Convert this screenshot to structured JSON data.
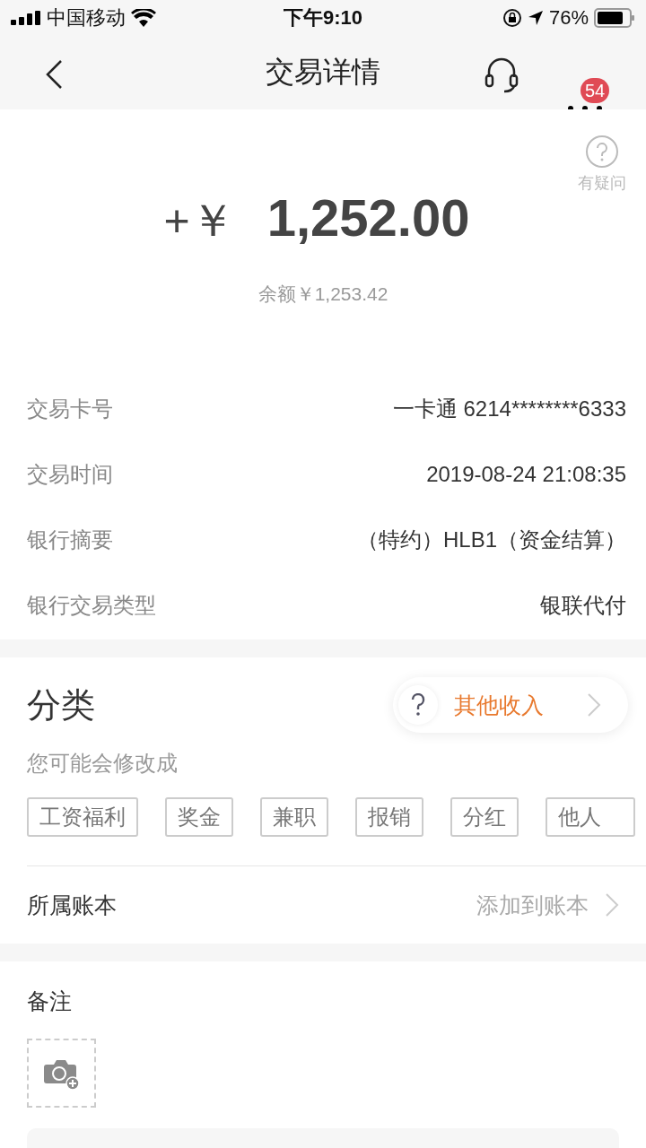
{
  "status_bar": {
    "carrier": "中国移动",
    "time": "下午9:10",
    "battery": "76%"
  },
  "nav": {
    "title": "交易详情",
    "badge": "54"
  },
  "help": {
    "label": "有疑问"
  },
  "amount": {
    "sign": "+￥",
    "value": "1,252.00",
    "balance": "余额￥1,253.42"
  },
  "details": [
    {
      "label": "交易卡号",
      "value": "一卡通 6214********6333"
    },
    {
      "label": "交易时间",
      "value": "2019-08-24 21:08:35"
    },
    {
      "label": "银行摘要",
      "value": "（特约）HLB1（资金结算）"
    },
    {
      "label": "银行交易类型",
      "value": "银联代付"
    }
  ],
  "category": {
    "title": "分类",
    "current": "其他收入",
    "hint": "您可能会修改成",
    "suggestions": [
      "工资福利",
      "奖金",
      "兼职",
      "报销",
      "分红",
      "他人"
    ]
  },
  "ledger": {
    "label": "所属账本",
    "action": "添加到账本"
  },
  "note": {
    "title": "备注"
  }
}
